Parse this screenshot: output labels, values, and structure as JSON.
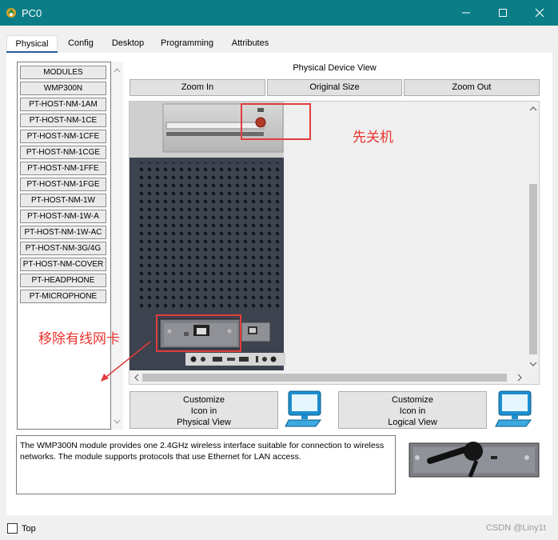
{
  "window": {
    "title": "PC0"
  },
  "tabs": [
    {
      "label": "Physical",
      "active": true
    },
    {
      "label": "Config",
      "active": false
    },
    {
      "label": "Desktop",
      "active": false
    },
    {
      "label": "Programming",
      "active": false
    },
    {
      "label": "Attributes",
      "active": false
    }
  ],
  "modules": [
    "MODULES",
    "WMP300N",
    "PT-HOST-NM-1AM",
    "PT-HOST-NM-1CE",
    "PT-HOST-NM-1CFE",
    "PT-HOST-NM-1CGE",
    "PT-HOST-NM-1FFE",
    "PT-HOST-NM-1FGE",
    "PT-HOST-NM-1W",
    "PT-HOST-NM-1W-A",
    "PT-HOST-NM-1W-AC",
    "PT-HOST-NM-3G/4G",
    "PT-HOST-NM-COVER",
    "PT-HEADPHONE",
    "PT-MICROPHONE"
  ],
  "physical_view": {
    "title": "Physical Device View",
    "zoom_in": "Zoom In",
    "original_size": "Original Size",
    "zoom_out": "Zoom Out"
  },
  "customize": {
    "physical": "Customize\nIcon in\nPhysical View",
    "logical": "Customize\nIcon in\nLogical View"
  },
  "description": "The WMP300N module provides one 2.4GHz wireless interface suitable for connection to wireless networks. The module supports protocols that use Ethernet for LAN access.",
  "footer": {
    "top_label": "Top",
    "watermark": "CSDN @Liny1t"
  },
  "annotations": {
    "power_off": "先关机",
    "remove_nic": "移除有线网卡"
  },
  "colors": {
    "titlebar": "#0b7d86",
    "annotation": "#e8352f",
    "tab_underline": "#2a5a9c"
  }
}
